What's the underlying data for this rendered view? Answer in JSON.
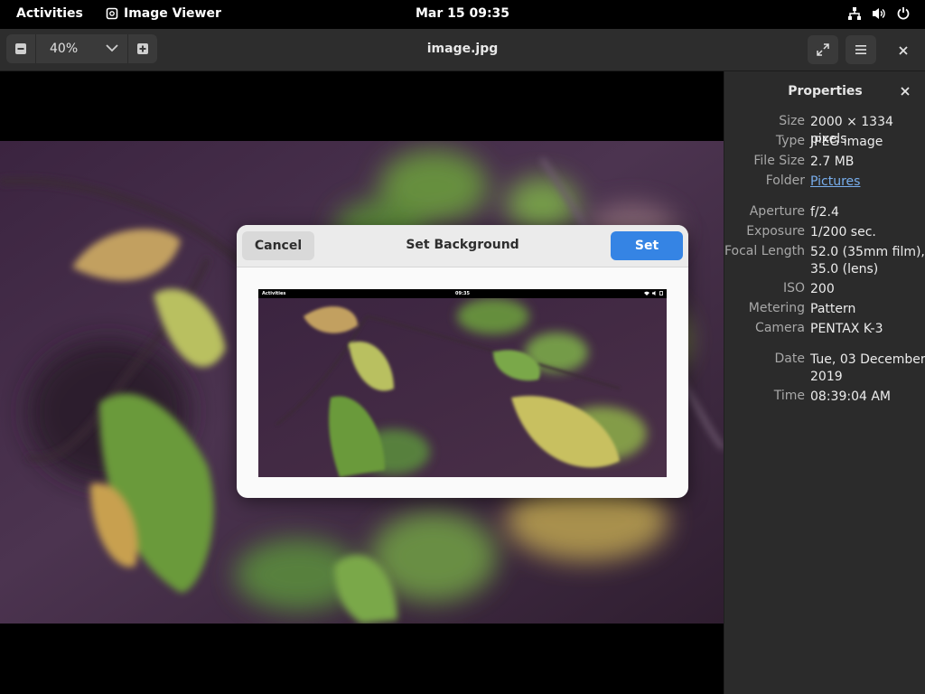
{
  "topbar": {
    "activities": "Activities",
    "app_name": "Image Viewer",
    "clock": "Mar 15  09:35"
  },
  "headerbar": {
    "zoom_level": "40%",
    "title": "image.jpg"
  },
  "properties": {
    "title": "Properties",
    "rows": [
      {
        "label": "Size",
        "value": "2000 × 1334 pixels"
      },
      {
        "label": "Type",
        "value": "JPEG image"
      },
      {
        "label": "File Size",
        "value": "2.7 MB"
      },
      {
        "label": "Folder",
        "value": "Pictures"
      },
      {
        "label": "Aperture",
        "value": "f/2.4"
      },
      {
        "label": "Exposure",
        "value": "1/200 sec."
      },
      {
        "label": "Focal Length",
        "value": "52.0 (35mm film), 35.0 (lens)"
      },
      {
        "label": "ISO",
        "value": "200"
      },
      {
        "label": "Metering",
        "value": "Pattern"
      },
      {
        "label": "Camera",
        "value": "PENTAX K-3"
      },
      {
        "label": "Date",
        "value": "Tue, 03 December 2019"
      },
      {
        "label": "Time",
        "value": "08:39:04 AM"
      }
    ]
  },
  "dialog": {
    "title": "Set Background",
    "cancel_label": "Cancel",
    "set_label": "Set",
    "preview_topbar": {
      "activities": "Activities",
      "clock": "09:35"
    }
  },
  "colors": {
    "accent": "#3584e4",
    "link": "#78aeed"
  }
}
